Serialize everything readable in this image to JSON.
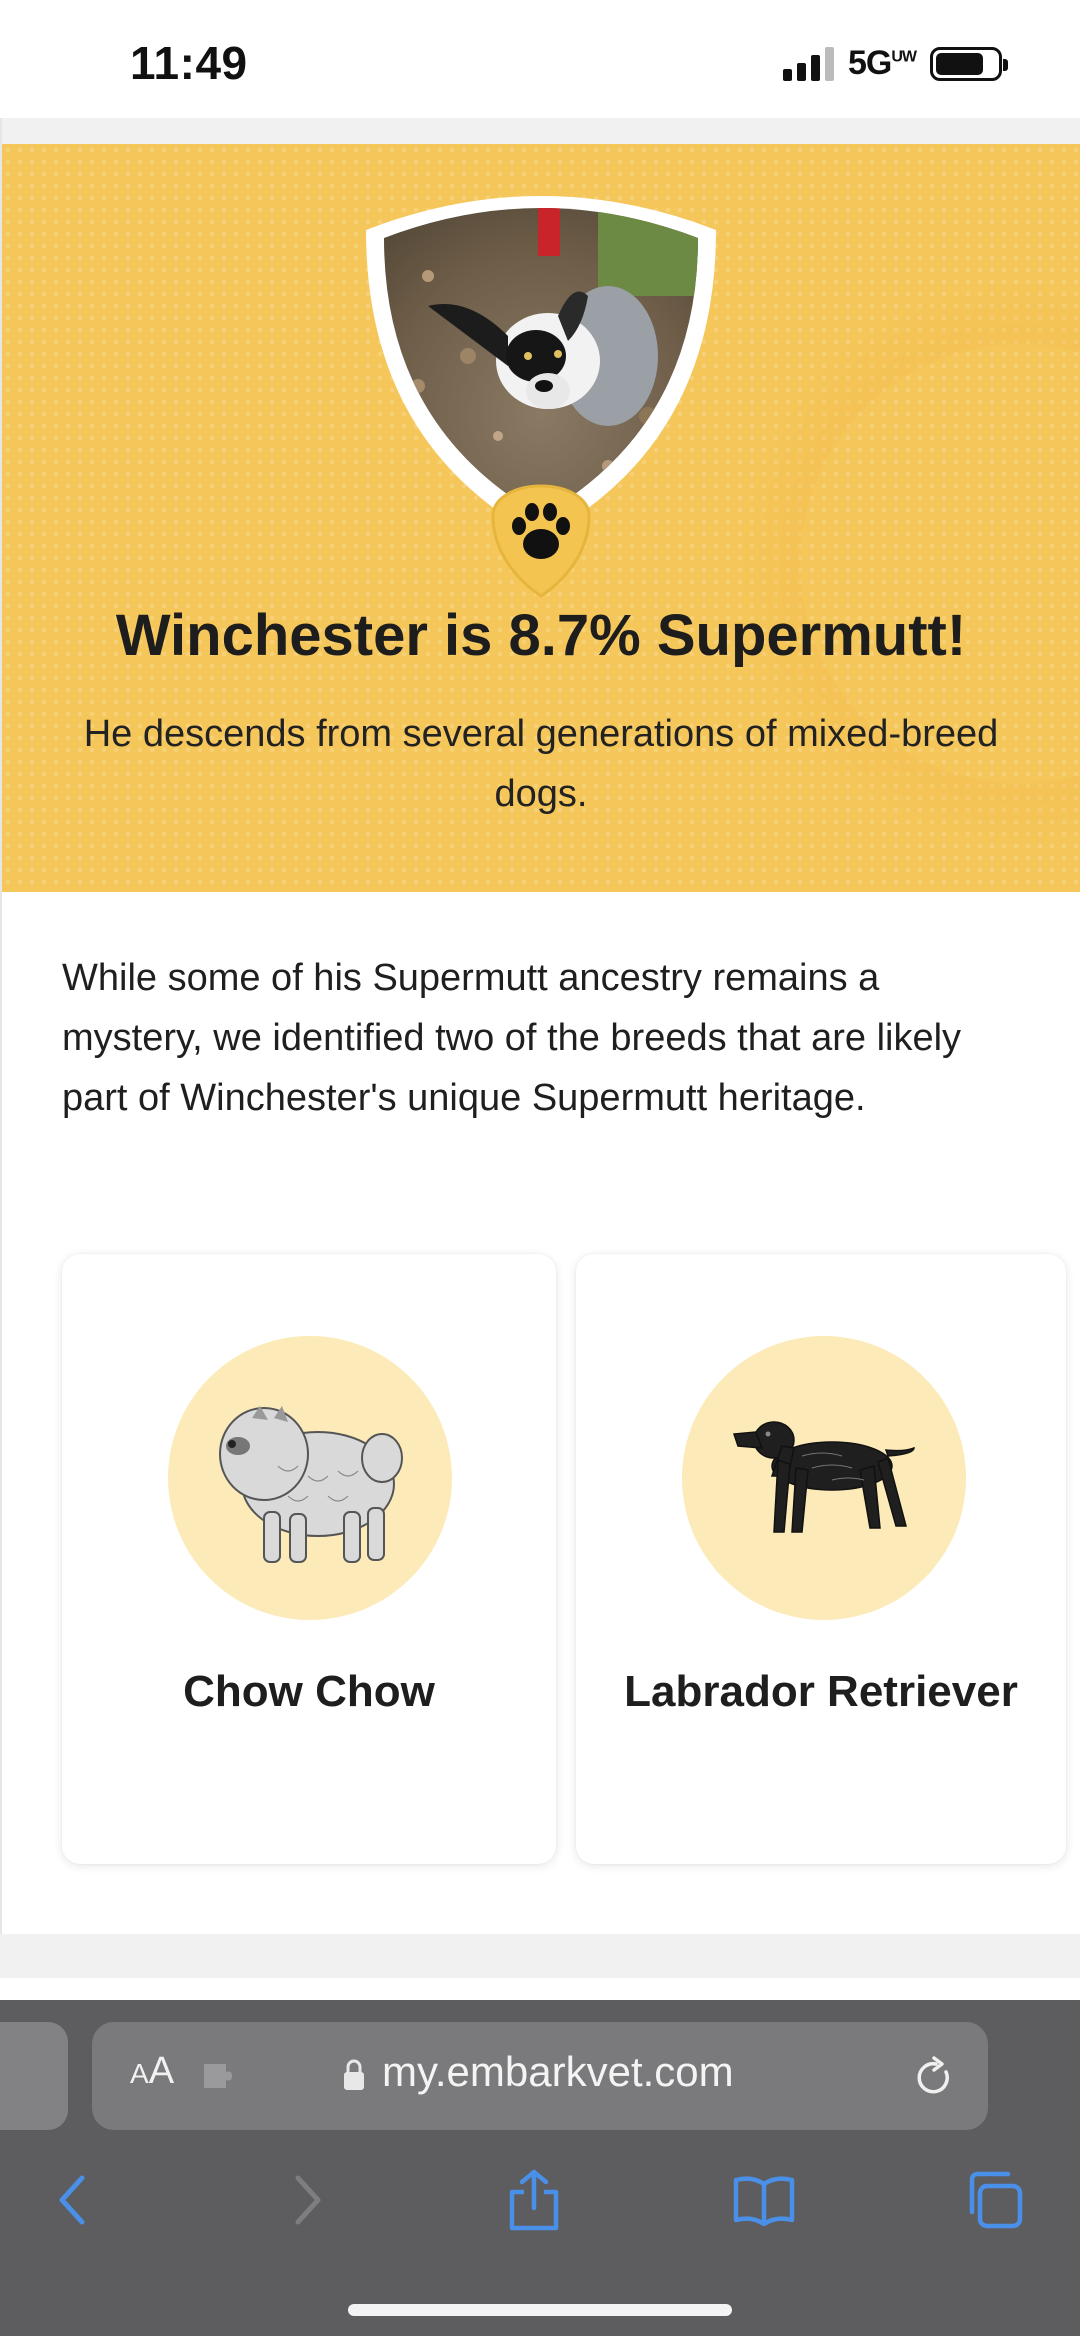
{
  "status_bar": {
    "time": "11:49",
    "network": "5G",
    "network_sup": "UW",
    "signal_bars": 3,
    "signal_total": 4,
    "battery_level": 0.8
  },
  "hero": {
    "title": "Winchester is 8.7% Supermutt!",
    "subtitle": "He descends from several generations of mixed-breed dogs.",
    "background_color": "#f5c75a",
    "badge_color": "#f3c450"
  },
  "intro": {
    "text": "While some of his Supermutt ancestry remains a mystery, we identified two of the breeds that are likely part of Winchester's unique Supermutt heritage."
  },
  "breeds": [
    {
      "name": "Chow Chow",
      "icon": "chow-chow-illustration"
    },
    {
      "name": "Labrador Retriever",
      "icon": "labrador-retriever-illustration"
    }
  ],
  "browser": {
    "text_size_label": "AA",
    "url": "my.embarkvet.com",
    "accent_color": "#4a8fe8"
  }
}
